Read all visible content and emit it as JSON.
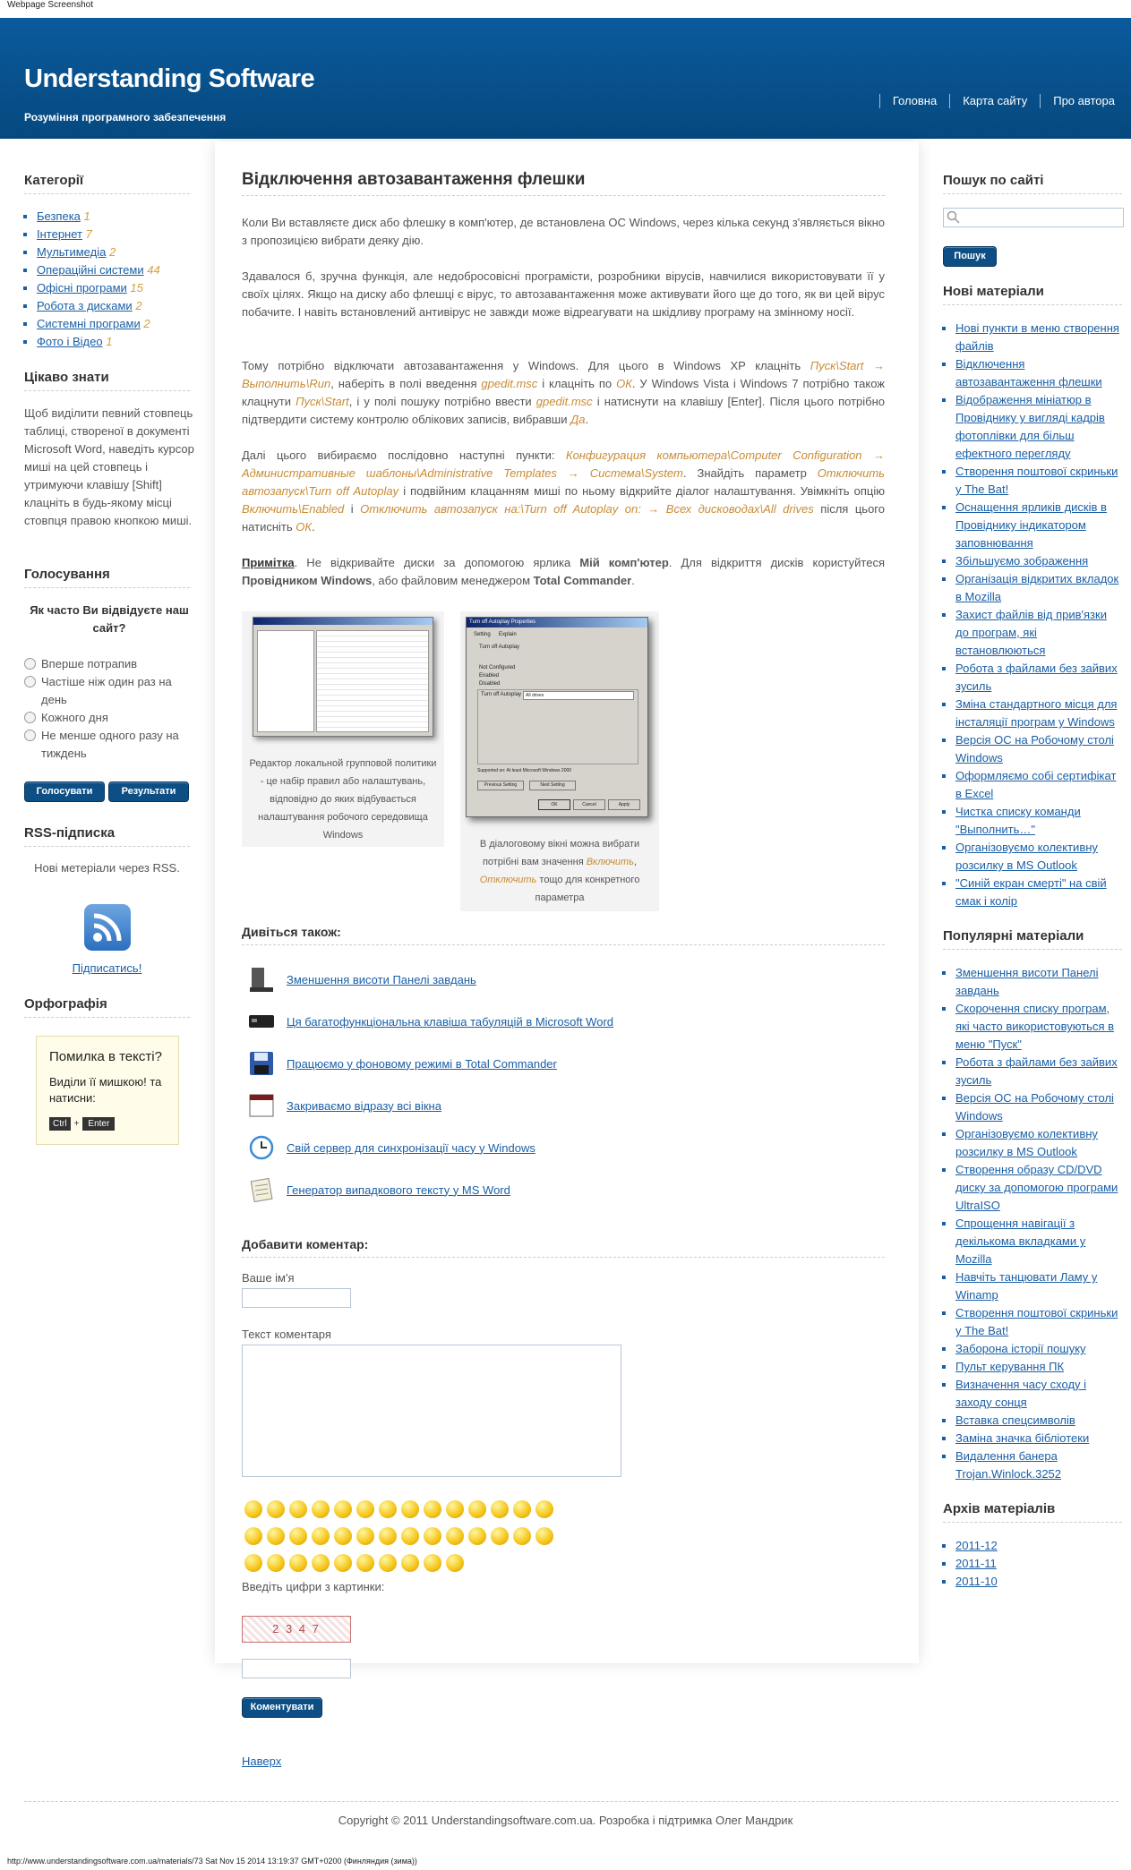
{
  "caption": "Webpage Screenshot",
  "header": {
    "title": "Understanding Software",
    "subtitle": "Розуміння програмного забезпечення",
    "nav": [
      "Головна",
      "Карта сайту",
      "Про автора"
    ]
  },
  "left": {
    "categories_title": "Категорії",
    "categories": [
      {
        "label": "Безпека",
        "count": "1"
      },
      {
        "label": "Інтернет",
        "count": "7"
      },
      {
        "label": "Мультимедіа",
        "count": "2"
      },
      {
        "label": "Операційні системи",
        "count": "44"
      },
      {
        "label": "Офісні програми",
        "count": "15"
      },
      {
        "label": "Робота з дисками",
        "count": "2"
      },
      {
        "label": "Системні програми",
        "count": "2"
      },
      {
        "label": "Фото і Відео",
        "count": "1"
      }
    ],
    "tip_title": "Цікаво знати",
    "tip_text": "Щоб виділити певний стовпець таблиці, створеної в документі Microsoft Word, наведіть курсор миші на цей стовпець і утримуючи клавішу [Shift] клацніть в будь-якому місці стовпця правою кнопкою миші.",
    "poll_title": "Голосування",
    "poll_question": "Як часто Ви відвідуєте наш сайт?",
    "poll_options": [
      "Вперше потрапив",
      "Частіше ніж один раз на день",
      "Кожного дня",
      "Не менше одного разу на тиждень"
    ],
    "vote_btn": "Голосувати",
    "results_btn": "Результати",
    "rss_title": "RSS-підписка",
    "rss_text": "Нові метеріали через RSS.",
    "rss_link": "Підписатись!",
    "spell_title": "Орфографія",
    "spell_box_title": "Помилка в тексті?",
    "spell_box_text": "Виділи її мишкою! та натисни:",
    "key_ctrl": "Ctrl",
    "key_plus": "+",
    "key_enter": "Enter"
  },
  "article": {
    "title": "Відключення автозавантаження флешки",
    "p1": "Коли Ви вставляєте диск або флешку в комп'ютер, де встановлена ОС Windows, через кілька секунд з'являється вікно з пропозицією вибрати деяку дію.",
    "p2": "Здавалося б, зручна функція, але недобросовісні програмісти, розробники вірусів, навчилися використовувати її у своїх цілях. Якщо на диску або флешці є вірус, то автозавантаження може активувати його ще до того, як ви цей вірус побачите. І навіть встановлений антивірус не завжди може відреагувати на шкідливу програму на змінному носії.",
    "p3": [
      {
        "t": "Тому потрібно відключати автозавантаження у Windows. Для цього в Windows XP клацніть "
      },
      {
        "t": "Пуск\\Start → Выполнить\\Run",
        "h": 1
      },
      {
        "t": ", наберіть в полі введення "
      },
      {
        "t": "gpedit.msc",
        "h": 1
      },
      {
        "t": " і клацніть по "
      },
      {
        "t": "ОК",
        "h": 1
      },
      {
        "t": ". У Windows Vista і Windows 7 потрібно також клацнути "
      },
      {
        "t": "Пуск\\Start",
        "h": 1
      },
      {
        "t": ", і у полі пошуку потрібно ввести "
      },
      {
        "t": "gpedit.msc",
        "h": 1
      },
      {
        "t": " і натиснути на клавішу [Enter]. Після цього потрібно підтвердити систему контролю облікових записів, вибравши "
      },
      {
        "t": "Да",
        "h": 1
      },
      {
        "t": "."
      }
    ],
    "p4": [
      {
        "t": "Далі цього вибираємо послідовно наступні пункти: "
      },
      {
        "t": "Конфигурация компьютера\\Computer Configuration → Административные шаблоны\\Administrative Templates → Система\\System",
        "h": 1
      },
      {
        "t": ". Знайдіть параметр "
      },
      {
        "t": "Отключить автозапуск\\Turn off Autoplay",
        "h": 1
      },
      {
        "t": " і подвійним клацанням миші по ньому відкрийте діалог налаштування. Увімкніть опцію "
      },
      {
        "t": "Включить\\Enabled",
        "h": 1
      },
      {
        "t": " і "
      },
      {
        "t": "Отключить автозапуск на:\\Turn off Autoplay on: → Всех дисководах\\All drives",
        "h": 1
      },
      {
        "t": " після цього натисніть "
      },
      {
        "t": "ОК",
        "h": 1
      },
      {
        "t": "."
      }
    ],
    "note_label": "Примітка",
    "note_a": ". Не відкривайте диски за допомогою ярлика ",
    "note_b": "Мій комп'ютер",
    "note_c": ". Для відкриття дисків користуйтеся ",
    "note_d": "Провідником Windows",
    "note_e": ", або файловим менеджером ",
    "note_f": "Total Commander",
    "note_g": ".",
    "img1_caption": "Редактор локальной групповой политики - це набір правил або налаштувань, відповідно до яких відбувається налаштування робочого середовища Windows",
    "img2_caption": [
      {
        "t": "В діалоговому вікні можна вибрати потрібні вам значення "
      },
      {
        "t": "Включить",
        "h": 1
      },
      {
        "t": ", "
      },
      {
        "t": "Отключить",
        "h": 1
      },
      {
        "t": " тощо для конкретного параметра"
      }
    ],
    "dlg_title": "Turn off Autoplay Properties",
    "dlg_tab1": "Setting",
    "dlg_tab2": "Explain",
    "dlg_policy": "Turn off Autoplay",
    "dlg_nc": "Not Configured",
    "dlg_en": "Enabled",
    "dlg_dis": "Disabled",
    "dlg_on": "Turn off Autoplay on:",
    "dlg_sel": "All drives",
    "dlg_sup": "Supported on:    At least Microsoft Windows 2000",
    "dlg_prev": "Previous Setting",
    "dlg_next": "Next Setting",
    "dlg_ok": "OK",
    "dlg_cancel": "Cancel",
    "dlg_apply": "Apply",
    "see_title": "Дивіться також:",
    "see": [
      "Зменшення висоти Панелі завдань",
      "Ця багатофункціональна клавіша табуляцій в Microsoft Word",
      "Працюємо у фоновому режимі в Total Commander",
      "Закриваємо відразу всі вікна",
      "Свій сервер для синхронізації часу у Windows",
      "Генератор випадкового тексту у MS Word"
    ],
    "comment_title": "Добавити коментар:",
    "name_label": "Ваше ім'я",
    "text_label": "Текст коментаря",
    "captcha_label": "Введіть цифри з картинки:",
    "captcha_text": "2 3 4 7",
    "comment_btn": "Коментувати",
    "top_link": "Наверх"
  },
  "right": {
    "search_title": "Пошук по сайті",
    "search_btn": "Пошук",
    "new_title": "Нові матеріали",
    "new": [
      "Нові пункти в меню створення файлів",
      "Відключення автозавантаження флешки",
      "Відображення мініатюр в Провіднику у вигляді кадрів фотоплівки для більш ефектного перегляду",
      "Створення поштової скриньки у The Bat!",
      "Оснащення ярликів дисків в Провіднику індикатором заповнювання",
      "Збільшуємо зображення",
      "Організація відкритих вкладок в Mozilla",
      "Захист файлів від прив'язки до програм, які встановлюються",
      "Робота з файлами без зайвих зусиль",
      "Зміна стандартного місця для інсталяції програм у Windows",
      "Версія ОС на Робочому столі Windows",
      "Оформляємо собі сертифікат в Excel",
      "Чистка списку команди \"Выполнить…\"",
      "Організовуємо колективну розсилку в MS Outlook",
      "\"Синій екран смерті\" на свій смак і колір"
    ],
    "popular_title": "Популярні матеріали",
    "popular": [
      "Зменшення висоти Панелі завдань",
      "Скорочення списку програм, які часто використовуються в меню \"Пуск\"",
      "Робота з файлами без зайвих зусиль",
      "Версія ОС на Робочому столі Windows",
      "Організовуємо колективну розсилку в MS Outlook",
      "Створення образу CD/DVD диску за допомогою програми UltraISO",
      "Спрощення навігації з декількома вкладками у Mozilla",
      "Навчіть танцювати Ламу у Winamp",
      "Створення поштової скриньки у The Bat!",
      "Заборона історії пошуку",
      "Пульт керування ПК",
      "Визначення часу сходу і заходу сонця",
      "Вставка спецсимволів",
      "Заміна значка бібліотеки",
      "Видалення банера Trojan.Winlock.3252"
    ],
    "archive_title": "Архів матеріалів",
    "archive": [
      "2011-12",
      "2011-11",
      "2011-10"
    ]
  },
  "footer": {
    "copyright": "Copyright © 2011 Understandingsoftware.com.ua. Розробка і підтримка Олег Мандрик"
  },
  "statusbar": "http://www.understandingsoftware.com.ua/materials/73 Sat Nov 15 2014 13:19:37 GMT+0200 (Финляндия (зима))"
}
